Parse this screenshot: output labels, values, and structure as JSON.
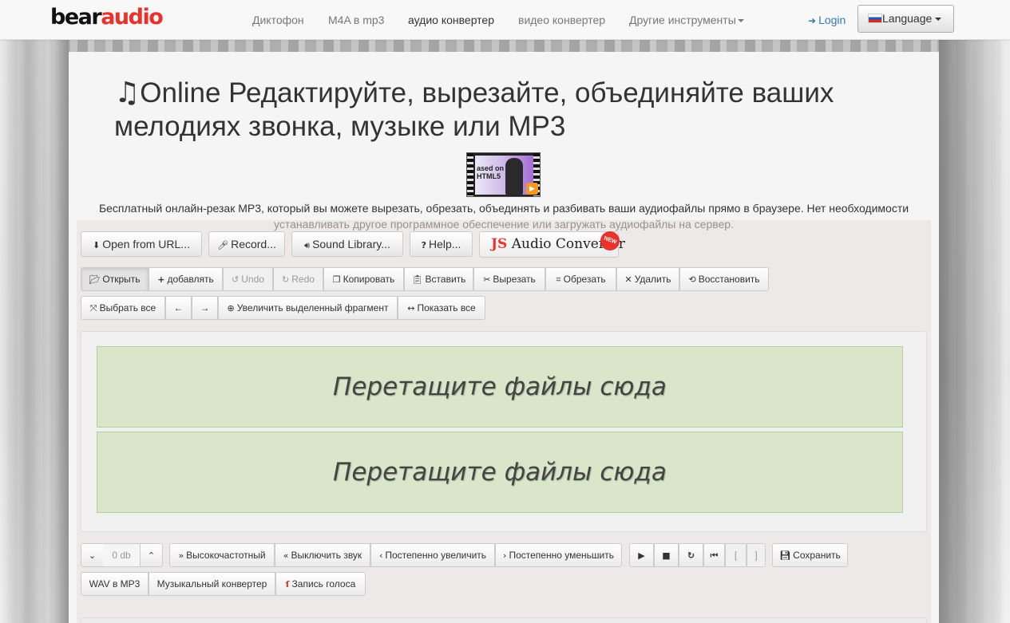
{
  "nav": {
    "logo_part1": "bear",
    "logo_part2": "audio",
    "links": [
      "Диктофон",
      "M4A в mp3",
      "аудио конвертер",
      "видео конвертер",
      "Другие инструменты"
    ],
    "login": "Login",
    "language": "Language"
  },
  "hero": {
    "title": "Online Редактируйте, вырезайте, объединяйте ваших мелодиях звонка, музыке или MP3",
    "video_thumb_text": "ased on HTML5",
    "description": "Бесплатный онлайн-резак MP3, который вы можете вырезать, обрезать, объединять и разбивать ваши аудиофайлы прямо в браузере. Нет необходимости устанавливать другое программное обеспечение или загружать аудиофайлы на сервер."
  },
  "top_buttons": {
    "open_url": "Open from URL...",
    "record": "Record...",
    "sound_library": "Sound Library...",
    "help": "Help...",
    "js_converter_js": "JS",
    "js_converter_rest": "Audio Converter",
    "new_badge": "NEW"
  },
  "edit_toolbar": {
    "open": "Открыть",
    "add": "добавлять",
    "undo": "Undo",
    "redo": "Redo",
    "copy": "Копировать",
    "paste": "Вставить",
    "cut": "Вырезать",
    "trim": "Обрезать",
    "delete": "Удалить",
    "restore": "Восстановить"
  },
  "select_toolbar": {
    "select_all": "Выбрать все",
    "left": "←",
    "right": "→",
    "zoom_selection": "Увеличить выделенный фрагмент",
    "show_all": "Показать все"
  },
  "drop_zones": [
    "Перетащите файлы сюда",
    "Перетащите файлы сюда"
  ],
  "effects_toolbar": {
    "volume_db": "0 db",
    "highpass": "Высокочастотный",
    "mute": "Выключить звук",
    "fade_in": "Постепенно увеличить",
    "fade_out": "Постепенно уменьшить",
    "bracket_open": "[",
    "bracket_close": "]",
    "save": "Сохранить"
  },
  "bottom_links": {
    "wav_mp3": "WAV в MP3",
    "music_converter": "Музыкальный конвертер",
    "voice_record": "Запись голоса"
  },
  "colors": {
    "brand_red": "#e8322b",
    "link_blue": "#337ab7",
    "drop_zone_green": "#d9e6c9"
  }
}
